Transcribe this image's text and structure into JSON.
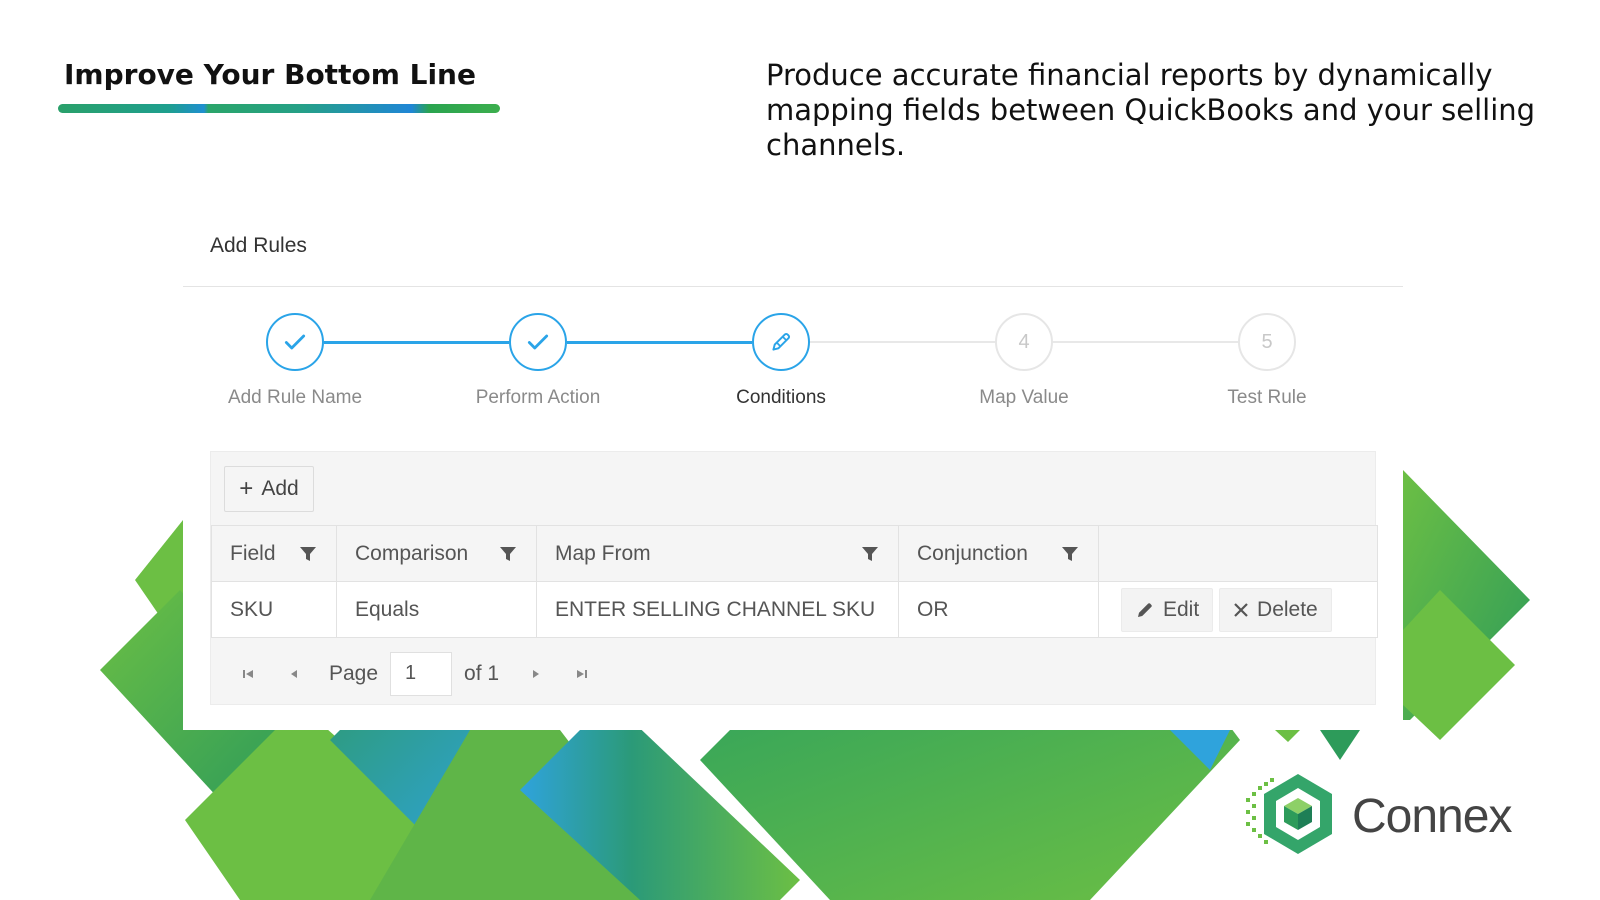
{
  "slide": {
    "headline": "Improve Your Bottom Line",
    "intro": "Produce accurate financial reports by dynamically mapping fields between QuickBooks and your selling channels."
  },
  "panel": {
    "title": "Add Rules"
  },
  "stepper": {
    "steps": [
      {
        "label": "Add Rule Name",
        "number": "1",
        "state": "done",
        "icon": "check-icon"
      },
      {
        "label": "Perform Action",
        "number": "2",
        "state": "done",
        "icon": "check-icon"
      },
      {
        "label": "Conditions",
        "number": "3",
        "state": "active",
        "icon": "pencil-icon"
      },
      {
        "label": "Map Value",
        "number": "4",
        "state": "pending"
      },
      {
        "label": "Test Rule",
        "number": "5",
        "state": "pending"
      }
    ]
  },
  "grid": {
    "add_label": "Add",
    "columns": [
      "Field",
      "Comparison",
      "Map From",
      "Conjunction"
    ],
    "rows": [
      {
        "field": "SKU",
        "comparison": "Equals",
        "map_from": "ENTER SELLING CHANNEL SKU",
        "conjunction": "OR"
      }
    ],
    "edit_label": "Edit",
    "delete_label": "Delete",
    "pager": {
      "page_label": "Page",
      "page_value": "1",
      "of_label": "of 1"
    }
  },
  "logo": {
    "text": "Connex"
  },
  "colors": {
    "accent": "#2aa4e8",
    "green": "#6cbf44",
    "teal": "#27927a",
    "blue": "#2fa3dc"
  }
}
